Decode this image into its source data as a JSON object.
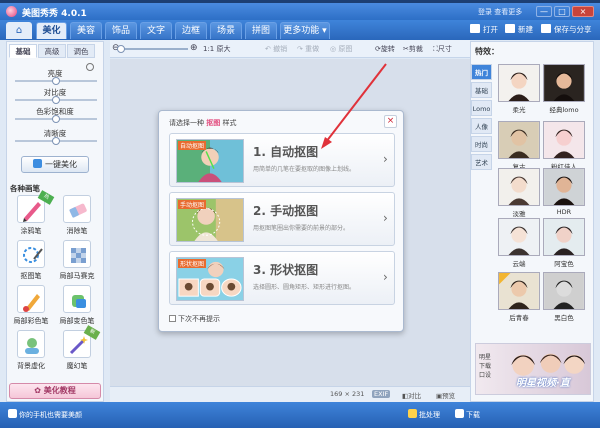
{
  "window": {
    "title": "美图秀秀 4.0.1",
    "right_text": "登录  查看更多",
    "controls": [
      "—",
      "□",
      "×"
    ]
  },
  "menu": {
    "home_icon": "home-icon",
    "tabs": [
      {
        "label": "美化",
        "active": true
      },
      {
        "label": "美容",
        "active": false
      },
      {
        "label": "饰品",
        "active": false
      },
      {
        "label": "文字",
        "active": false
      },
      {
        "label": "边框",
        "active": false
      },
      {
        "label": "场景",
        "active": false
      },
      {
        "label": "拼图",
        "active": false
      },
      {
        "label": "更多功能 ▾",
        "active": false
      }
    ],
    "actions": {
      "open": "打开",
      "new": "新建",
      "save": "保存与分享"
    }
  },
  "toolbar": {
    "original_size": "原大",
    "undo": "撤销",
    "redo": "重做",
    "restore": "原图",
    "rotate": "旋转",
    "crop": "剪裁",
    "resize": "尺寸"
  },
  "left": {
    "subtabs": [
      "基础",
      "高级",
      "调色"
    ],
    "adjustments": [
      "亮度",
      "对比度",
      "色彩饱和度",
      "清晰度"
    ],
    "one_key": "一键美化",
    "brushes_title": "各种画笔",
    "brushes": [
      {
        "label": "涂鸦笔",
        "icon": "doodle-brush-icon",
        "tag": "热"
      },
      {
        "label": "消除笔",
        "icon": "eraser-brush-icon",
        "tag": ""
      },
      {
        "label": "抠图笔",
        "icon": "cutout-brush-icon",
        "tag": ""
      },
      {
        "label": "局部马赛克",
        "icon": "mosaic-brush-icon",
        "tag": ""
      },
      {
        "label": "局部彩色笔",
        "icon": "color-brush-icon",
        "tag": ""
      },
      {
        "label": "局部变色笔",
        "icon": "recolor-brush-icon",
        "tag": ""
      },
      {
        "label": "背景虚化",
        "icon": "blur-background-icon",
        "tag": ""
      },
      {
        "label": "魔幻笔",
        "icon": "magic-brush-icon",
        "tag": "新"
      }
    ],
    "tutorial": "美化教程"
  },
  "dialog": {
    "title_prefix": "请选择一种",
    "title_highlight": "抠图",
    "title_suffix": "样式",
    "options": [
      {
        "badge": "自动抠图",
        "title": "1. 自动抠图",
        "desc": "用简单的几笔在要抠取的图像上划线。"
      },
      {
        "badge": "手动抠图",
        "title": "2. 手动抠图",
        "desc": "用抠图笔圈出你需要的前景的部分。"
      },
      {
        "badge": "形状抠图",
        "title": "3. 形状抠图",
        "desc": "选择圆形、圆角矩形、矩形进行抠图。"
      }
    ],
    "no_show": "下次不再提示"
  },
  "status": {
    "size": "169 × 231",
    "exif": "EXIF",
    "compare": "对比",
    "preview": "预览"
  },
  "right": {
    "title": "特效：",
    "tabs": [
      {
        "label": "热门",
        "active": true
      },
      {
        "label": "基础",
        "active": false
      },
      {
        "label": "Lomo",
        "active": false
      },
      {
        "label": "人像",
        "active": false
      },
      {
        "label": "时尚",
        "active": false
      },
      {
        "label": "艺术",
        "active": false
      }
    ],
    "effects": [
      "柔光",
      "经典lomo",
      "复古",
      "粉红佳人",
      "淡雅",
      "HDR",
      "云端",
      "阿宝色",
      "后青春",
      "黑白色"
    ],
    "ad_side": "明星\n下载\n口设",
    "ad_text": "明星视频·直"
  },
  "taskbar": {
    "left": "你的手机也需要美颜",
    "batch": "批处理",
    "download": "下载"
  },
  "colors": {
    "accent": "#3f84da",
    "highlight": "#e24a7c",
    "arrow": "#e0323a"
  }
}
